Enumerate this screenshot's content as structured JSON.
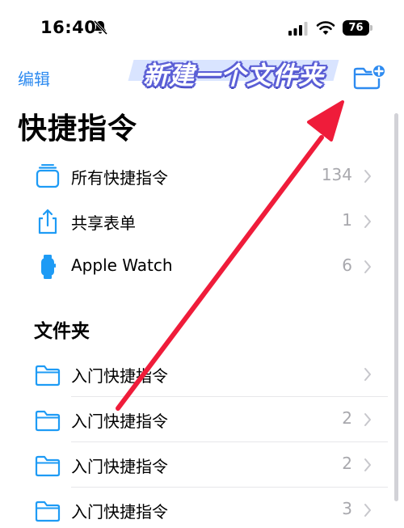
{
  "status_bar": {
    "time": "16:40",
    "battery": "76"
  },
  "nav": {
    "edit_label": "编辑"
  },
  "overlay": {
    "caption": "新建一个文件夹"
  },
  "page_title": "快捷指令",
  "main_list": [
    {
      "label": "所有快捷指令",
      "count": "134",
      "icon": "stack-icon"
    },
    {
      "label": "共享表单",
      "count": "1",
      "icon": "share-icon"
    },
    {
      "label": "Apple Watch",
      "count": "6",
      "icon": "watch-icon"
    }
  ],
  "folders_section": {
    "header": "文件夹",
    "items": [
      {
        "label": "入门快捷指令",
        "count": "",
        "icon": "folder-icon"
      },
      {
        "label": "入门快捷指令",
        "count": "2",
        "icon": "folder-icon"
      },
      {
        "label": "入门快捷指令",
        "count": "2",
        "icon": "folder-icon"
      },
      {
        "label": "入门快捷指令",
        "count": "3",
        "icon": "folder-icon"
      }
    ]
  },
  "colors": {
    "accent": "#2e8bf0",
    "icon": "#1e9bf5",
    "secondary_text": "#a8a8ad",
    "arrow": "#ef1c3a"
  }
}
